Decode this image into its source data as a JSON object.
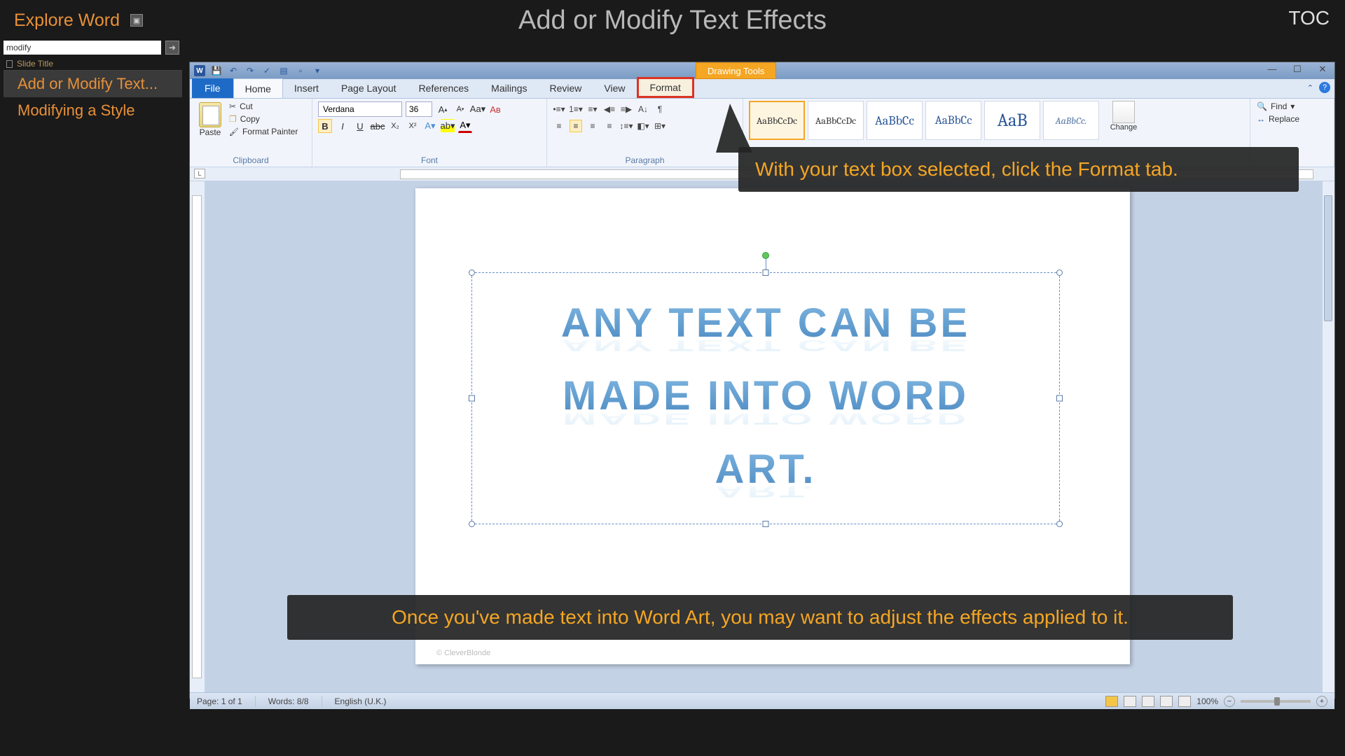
{
  "header": {
    "left_title": "Explore Word",
    "center_title": "Add or Modify Text Effects",
    "toc": "TOC"
  },
  "sidebar": {
    "search_value": "modify",
    "slide_title_label": "Slide Title",
    "items": [
      {
        "label": "Add or Modify Text..."
      },
      {
        "label": "Modifying a Style"
      }
    ]
  },
  "word": {
    "drawing_tools_label": "Drawing Tools",
    "tabs": {
      "file": "File",
      "home": "Home",
      "insert": "Insert",
      "page_layout": "Page Layout",
      "references": "References",
      "mailings": "Mailings",
      "review": "Review",
      "view": "View",
      "format": "Format"
    },
    "ribbon": {
      "clipboard": {
        "paste": "Paste",
        "cut": "Cut",
        "copy": "Copy",
        "format_painter": "Format Painter",
        "group": "Clipboard"
      },
      "font": {
        "name": "Verdana",
        "size": "36",
        "group": "Font"
      },
      "paragraph": {
        "group": "Paragraph"
      },
      "styles": {
        "s1": "AaBbCcDc",
        "s2": "AaBbCcDc",
        "s3": "AaBbCc",
        "s4": "AaBbCc",
        "s5": "AaB",
        "s6": "AaBbCc.",
        "change": "Change"
      },
      "editing": {
        "find": "Find",
        "replace": "Replace"
      }
    },
    "document": {
      "line1": "ANY TEXT CAN BE",
      "line2": "MADE INTO WORD",
      "line3": "ART.",
      "footer": "© CleverBlonde"
    },
    "status": {
      "page": "Page: 1 of 1",
      "words": "Words: 8/8",
      "lang": "English (U.K.)",
      "zoom": "100%"
    }
  },
  "callouts": {
    "c1": "With your text box selected, click the Format tab.",
    "c2": "Once you've made text into Word Art, you may want to adjust the effects applied to it."
  }
}
